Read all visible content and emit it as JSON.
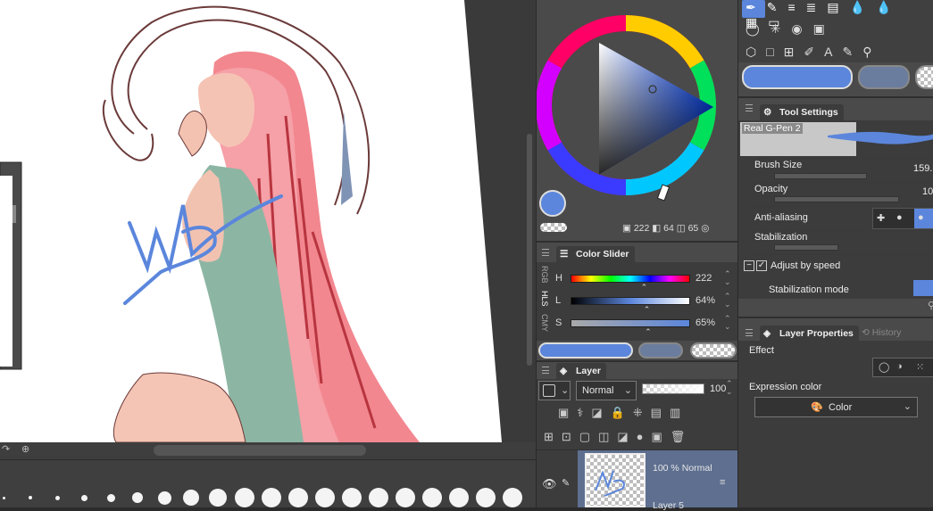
{
  "brush_sizes": [
    "",
    "",
    "",
    "",
    "",
    "",
    "",
    "",
    "",
    "",
    "",
    "",
    "",
    "",
    "",
    "",
    "",
    "",
    "",
    ""
  ],
  "color_wheel": {
    "h_readout": "222",
    "s_readout": "64",
    "v_readout": "65",
    "main_color": "#5b86dc"
  },
  "color_slider": {
    "tab_label": "Color Slider",
    "side_modes": [
      "RGB",
      "HLS",
      "CMY"
    ],
    "rows": [
      {
        "letter": "H",
        "value": "222",
        "pct": 0.617
      },
      {
        "letter": "L",
        "value": "64%",
        "pct": 0.64
      },
      {
        "letter": "S",
        "value": "65%",
        "pct": 0.65
      }
    ]
  },
  "layer_panel": {
    "tab_label": "Layer",
    "blend_mode": "Normal",
    "opacity": "100",
    "layer_opacity_mode": "100 % Normal",
    "layer_name": "Layer 5"
  },
  "tool_settings": {
    "tab_label": "Tool Settings",
    "brush_name": "Real G-Pen 2",
    "brush_size_label": "Brush Size",
    "brush_size_value": "159.",
    "opacity_label": "Opacity",
    "opacity_value": "10",
    "antialiasing_label": "Anti-aliasing",
    "stabilization_label": "Stabilization",
    "adjust_by_speed_label": "Adjust by speed",
    "stabilization_mode_label": "Stabilization mode"
  },
  "layer_properties": {
    "tab_label": "Layer Properties",
    "history_tab_label": "History",
    "effect_label": "Effect",
    "expression_color_label": "Expression color",
    "expression_color_value": "Color"
  },
  "colors": {
    "accent": "#5b86dc",
    "panel": "#4a4a4a",
    "dark": "#2b2b2b"
  }
}
